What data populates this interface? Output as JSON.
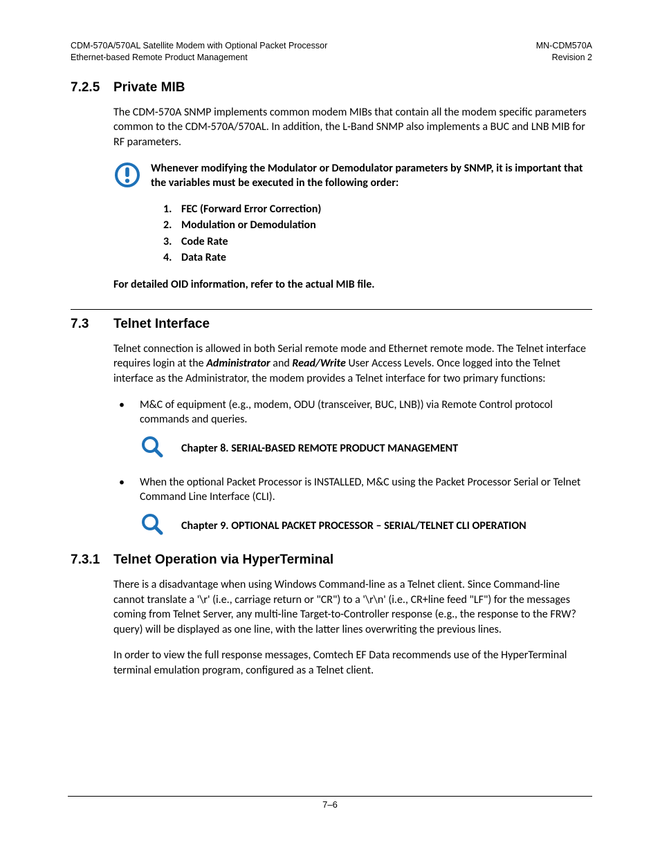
{
  "header": {
    "left_line1": "CDM-570A/570AL Satellite Modem with Optional Packet Processor",
    "left_line2": "Ethernet-based Remote Product Management",
    "right_line1": "MN-CDM570A",
    "right_line2": "Revision 2"
  },
  "s725": {
    "num": "7.2.5",
    "title": "Private MIB",
    "p1": "The CDM-570A SNMP implements common modem MIBs that contain all the modem specific parameters common to the CDM-570A/570AL. In addition, the L-Band SNMP also implements a BUC and LNB MIB for RF parameters.",
    "warn": "Whenever modifying the Modulator or Demodulator parameters by SNMP, it is important that the variables must be executed in the following order:",
    "list": [
      "FEC (Forward Error Correction)",
      "Modulation or Demodulation",
      "Code Rate",
      "Data Rate"
    ],
    "oid": "For detailed OID information, refer to the actual MIB file."
  },
  "s73": {
    "num": "7.3",
    "title": "Telnet Interface",
    "p1a": "Telnet connection is allowed in both Serial remote mode and Ethernet remote mode. The Telnet interface requires login at the ",
    "admin": "Administrator",
    "p1b": " and ",
    "rw": "Read/Write",
    "p1c": " User Access Levels. Once logged into the Telnet interface as the Administrator, the modem provides a Telnet interface for two primary functions:",
    "b1": "M&C of equipment (e.g., modem, ODU (transceiver, BUC, LNB)) via Remote Control protocol commands and queries.",
    "ref1": "Chapter 8. SERIAL-BASED REMOTE PRODUCT MANAGEMENT",
    "b2": "When the optional Packet Processor is INSTALLED, M&C using the Packet Processor Serial or Telnet Command Line Interface (CLI).",
    "ref2": "Chapter 9. OPTIONAL PACKET PROCESSOR – SERIAL/TELNET CLI OPERATION"
  },
  "s731": {
    "num": "7.3.1",
    "title": "Telnet Operation via HyperTerminal",
    "p1": "There is a disadvantage when using Windows Command-line as a Telnet client. Since Command-line cannot translate a '\\r' (i.e., carriage return or \"CR\") to a '\\r\\n' (i.e., CR+line feed \"LF\") for the messages coming from Telnet Server, any multi-line Target-to-Controller response (e.g., the response to the FRW? query) will be displayed as one line, with the latter lines overwriting the previous lines.",
    "p2": "In order to view the full response messages, Comtech EF Data recommends use of the HyperTerminal terminal emulation program, configured as a Telnet client."
  },
  "footer": {
    "page": "7–6"
  }
}
